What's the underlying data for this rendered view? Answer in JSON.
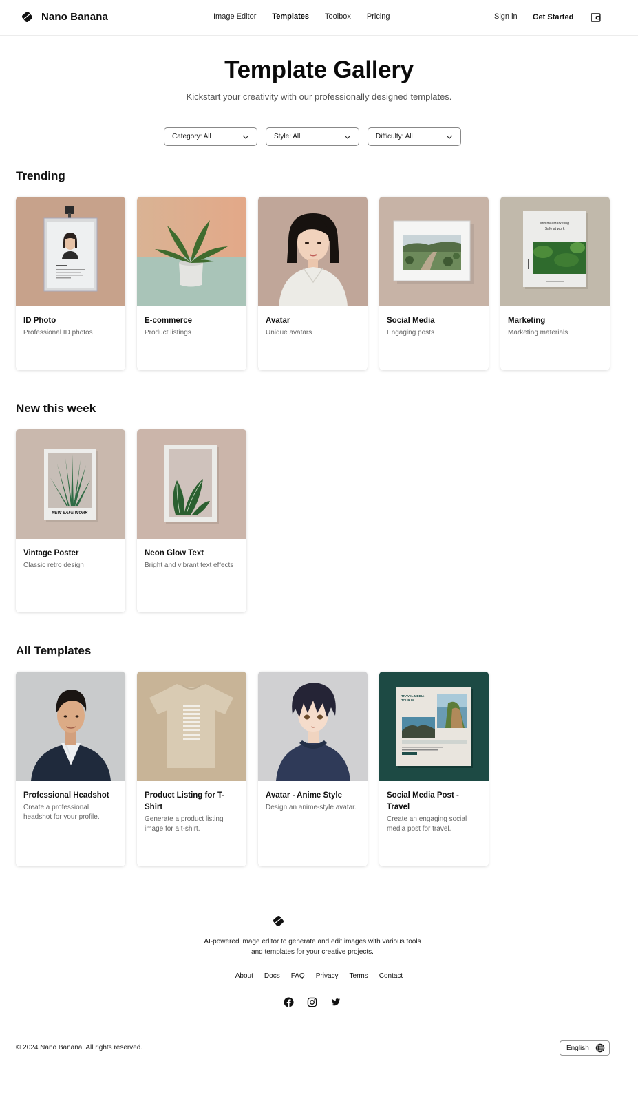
{
  "header": {
    "brand": "Nano Banana",
    "nav": [
      "Image Editor",
      "Templates",
      "Toolbox",
      "Pricing"
    ],
    "active_nav": "Templates",
    "signin": "Sign in",
    "get_started": "Get Started"
  },
  "hero": {
    "title": "Template Gallery",
    "subtitle": "Kickstart your creativity with our professionally designed templates."
  },
  "filters": [
    "Category: All",
    "Style: All",
    "Difficulty: All"
  ],
  "sections": {
    "trending": {
      "title": "Trending",
      "cards": [
        {
          "title": "ID Photo",
          "desc": "Professional ID photos"
        },
        {
          "title": "E-commerce",
          "desc": "Product listings"
        },
        {
          "title": "Avatar",
          "desc": "Unique avatars"
        },
        {
          "title": "Social Media",
          "desc": "Engaging posts"
        },
        {
          "title": "Marketing",
          "desc": "Marketing materials"
        }
      ]
    },
    "new": {
      "title": "New this week",
      "cards": [
        {
          "title": "Vintage Poster",
          "desc": "Classic retro design"
        },
        {
          "title": "Neon Glow Text",
          "desc": "Bright and vibrant text effects"
        }
      ]
    },
    "all": {
      "title": "All Templates",
      "cards": [
        {
          "title": "Professional Headshot",
          "desc": "Create a professional headshot for your profile."
        },
        {
          "title": "Product Listing for T-Shirt",
          "desc": "Generate a product listing image for a t-shirt."
        },
        {
          "title": "Avatar - Anime Style",
          "desc": "Design an anime-style avatar."
        },
        {
          "title": "Social Media Post - Travel",
          "desc": "Create an engaging social media post for travel."
        }
      ]
    }
  },
  "thumb_text": {
    "poster_caption": "NEW SAFE WORK",
    "marketing_line1": "Minimal Marketing",
    "marketing_line2": "Safe at work",
    "travel_line1": "TRAVEL MEDIA",
    "travel_line2": "TOUR IN"
  },
  "footer": {
    "description": "AI-powered image editor to generate and edit images with various tools and templates for your creative projects.",
    "links": [
      "About",
      "Docs",
      "FAQ",
      "Privacy",
      "Terms",
      "Contact"
    ],
    "social_icons": [
      "facebook-icon",
      "instagram-icon",
      "twitter-icon"
    ],
    "copyright": "© 2024 Nano Banana. All rights reserved.",
    "language": "English"
  }
}
